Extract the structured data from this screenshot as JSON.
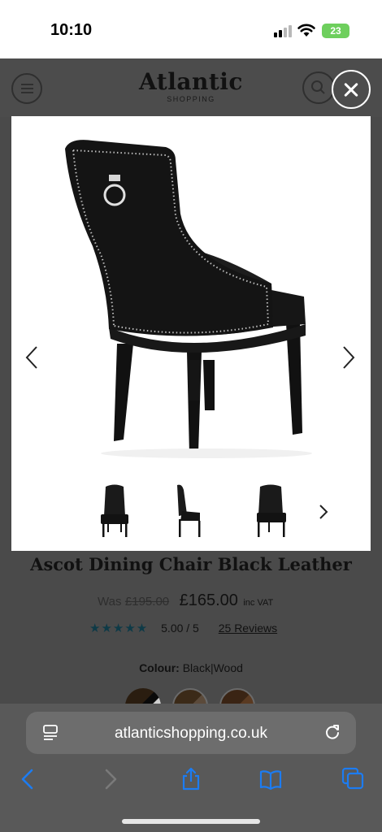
{
  "status": {
    "time": "10:10",
    "battery": "23"
  },
  "site": {
    "brand": "Atlantic",
    "brand_sub": "SHOPPING"
  },
  "product": {
    "title": "Ascot Dining Chair Black Leather",
    "was_label": "Was",
    "was_price": "£195.00",
    "price": "£165.00",
    "vat_label": "inc VAT",
    "stars": "★★★★★",
    "rating": "5.00 / 5",
    "reviews": "25 Reviews",
    "colour_label": "Colour:",
    "colour_value": "Black|Wood"
  },
  "browser": {
    "url": "atlanticshopping.co.uk"
  },
  "icons": [
    "menu-icon",
    "search-icon",
    "close-icon",
    "chevron-left-icon",
    "chevron-right-icon",
    "reader-icon",
    "reload-icon",
    "back-icon",
    "forward-icon",
    "share-icon",
    "bookmarks-icon",
    "tabs-icon"
  ],
  "colors": {
    "accent": "#0e3a47",
    "ios_blue": "#1c7cf2",
    "overlay": "#4a4a4a"
  }
}
